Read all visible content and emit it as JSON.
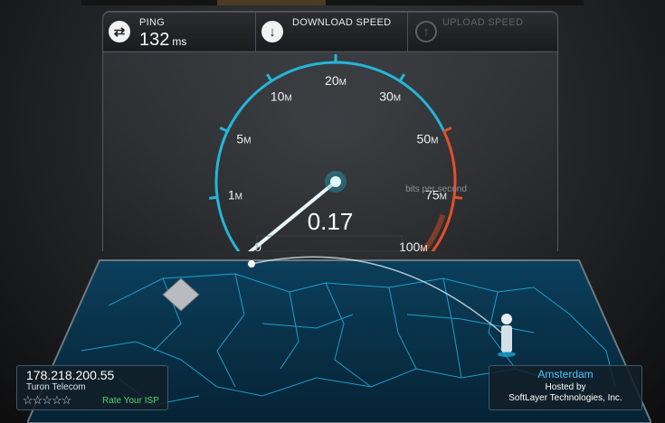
{
  "header": {
    "ping": {
      "label": "PING",
      "value": "132",
      "unit": "ms",
      "icon": "ping-icon"
    },
    "download": {
      "label": "DOWNLOAD SPEED",
      "icon": "download-arrow-icon"
    },
    "upload": {
      "label": "UPLOAD SPEED",
      "icon": "upload-arrow-icon"
    }
  },
  "gauge": {
    "ticks": [
      {
        "num": "0",
        "unit": ""
      },
      {
        "num": "1",
        "unit": "M"
      },
      {
        "num": "5",
        "unit": "M"
      },
      {
        "num": "10",
        "unit": "M"
      },
      {
        "num": "20",
        "unit": "M"
      },
      {
        "num": "30",
        "unit": "M"
      },
      {
        "num": "50",
        "unit": "M"
      },
      {
        "num": "75",
        "unit": "M"
      },
      {
        "num": "100",
        "unit": "M"
      }
    ],
    "units_label": "bits per second",
    "current_value": "0.17",
    "accent_color": "#25b5d8",
    "high_color": "#e2502a"
  },
  "client": {
    "ip": "178.218.200.55",
    "isp": "Turon Telecom",
    "rating_stars": 0,
    "rating_max": 5,
    "rate_label": "Rate Your ISP"
  },
  "server": {
    "city": "Amsterdam",
    "hosted_by": "Hosted by",
    "host": "SoftLayer Technologies, Inc."
  }
}
